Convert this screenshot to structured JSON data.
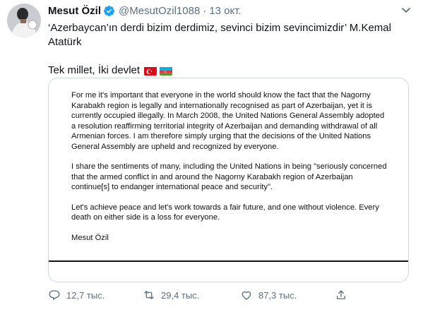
{
  "author": {
    "name": "Mesut Özil",
    "handle": "@MesutOzil1088",
    "separator": "·",
    "time": "13 окт."
  },
  "tweet": {
    "line1": "‘Azerbaycan’ın derdi bizim derdimiz, sevinci bizim sevincimizdir’ M.Kemal Atatürk",
    "line2": "Tek millet, İki devlet"
  },
  "document": {
    "paragraph1": "For me it's important that everyone in the world should know the fact that the Nagorny Karabakh region is legally and internationally recognised as part of Azerbaijan, yet it is currently occupied illegally. In March 2008, the United Nations General Assembly adopted a resolution reaffirming territorial integrity of Azerbaijan and demanding withdrawal of all Armenian forces. I am therefore simply urging that the decisions of the United Nations General Assembly are upheld and recognized by everyone.",
    "paragraph2": "I share the sentiments of many, including the United Nations in being \"seriously concerned that the armed conflict in and around the Nagorny Karabakh region of Azerbaijan continue[s] to endanger international peace and security\".",
    "paragraph3": "Let's achieve peace and let's work towards a fair future, and one without violence. Every death on either side is a loss for everyone.",
    "signature": "Mesut Özil"
  },
  "actions": {
    "replies": "12,7 тыс.",
    "retweets": "29,4 тыс.",
    "likes": "87,3 тыс."
  },
  "colors": {
    "verified": "#1da1f2",
    "muted": "#5b7083",
    "border": "#cfd9de"
  }
}
